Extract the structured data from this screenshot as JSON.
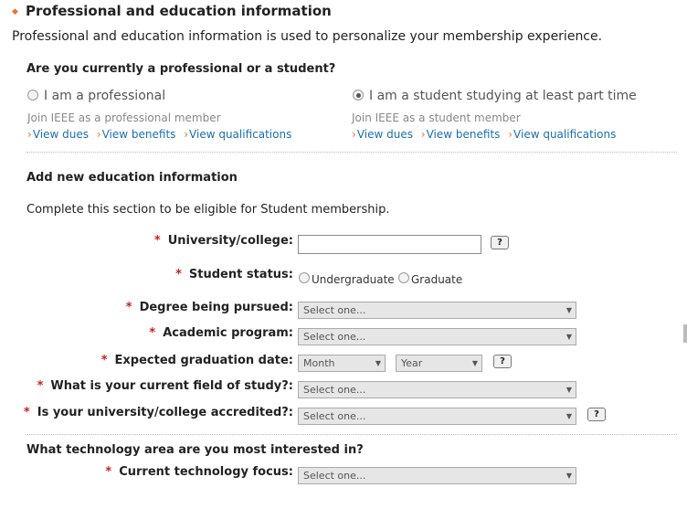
{
  "section": {
    "title": "Professional and education information",
    "intro": "Professional and education information is used to personalize your membership experience."
  },
  "membership_type": {
    "question": "Are you currently a professional or a student?",
    "options": [
      {
        "label": "I am a professional",
        "checked": false,
        "subtitle": "Join IEEE as a professional member",
        "links": [
          "View dues",
          "View benefits",
          "View qualifications"
        ]
      },
      {
        "label": "I am a student studying at least part time",
        "checked": true,
        "subtitle": "Join IEEE as a student member",
        "links": [
          "View dues",
          "View benefits",
          "View qualifications"
        ]
      }
    ]
  },
  "education": {
    "title": "Add new education information",
    "note": "Complete this section to be eligible for Student membership.",
    "required_mark": "*",
    "help_label": "?",
    "fields": {
      "university": {
        "label": "University/college:",
        "value": ""
      },
      "student_status": {
        "label": "Student status:",
        "options": [
          "Undergraduate",
          "Graduate"
        ]
      },
      "degree": {
        "label": "Degree being pursued:",
        "value": "Select one..."
      },
      "program": {
        "label": "Academic program:",
        "value": "Select one..."
      },
      "grad_date": {
        "label": "Expected graduation date:",
        "month": "Month",
        "year": "Year"
      },
      "field_of_study": {
        "label": "What is your current field of study?:",
        "value": "Select one..."
      },
      "accredited": {
        "label": "Is your university/college accredited?:",
        "value": "Select one..."
      }
    }
  },
  "technology": {
    "title": "What technology area are you most interested in?",
    "focus": {
      "label": "Current technology focus:",
      "value": "Select one..."
    }
  },
  "icons": {
    "arrow": "dropdown-arrow-icon",
    "chevron": "chevron-right-icon",
    "bullet": "diamond-icon"
  },
  "colors": {
    "accent": "#e8772e",
    "link": "#1a6fb0",
    "required": "#cc1f1f"
  }
}
